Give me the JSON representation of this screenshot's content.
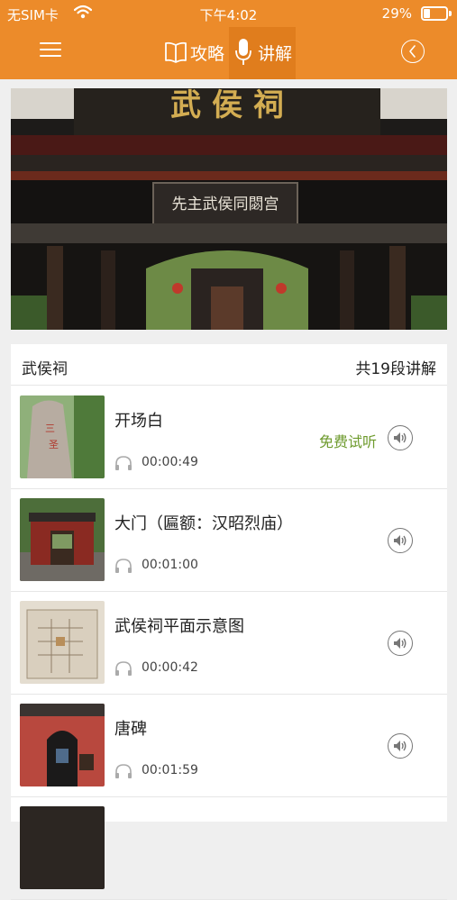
{
  "status": {
    "carrier": "无SIM卡",
    "time": "下午4:02",
    "battery_pct": "29%",
    "battery_level": 0.29
  },
  "nav": {
    "tabs": [
      {
        "label": "攻略",
        "icon": "book-icon"
      },
      {
        "label": "讲解",
        "icon": "microphone-icon",
        "active": true
      }
    ],
    "colors": {
      "bar": "#ec8b2a",
      "active_tab": "#e07d1d"
    }
  },
  "hero": {
    "sign_text": "先主武侯同閟宫",
    "lintel_text": "武 侯 祠"
  },
  "list": {
    "title": "武侯祠",
    "count_label": "共19段讲解",
    "items": [
      {
        "title": "开场白",
        "duration": "00:00:49",
        "free_label": "免费试听"
      },
      {
        "title": "大门（匾额：汉昭烈庙）",
        "duration": "00:01:00"
      },
      {
        "title": "武侯祠平面示意图",
        "duration": "00:00:42"
      },
      {
        "title": "唐碑",
        "duration": "00:01:59"
      }
    ]
  },
  "colors": {
    "free": "#6d9a2c",
    "background": "#efefef"
  }
}
